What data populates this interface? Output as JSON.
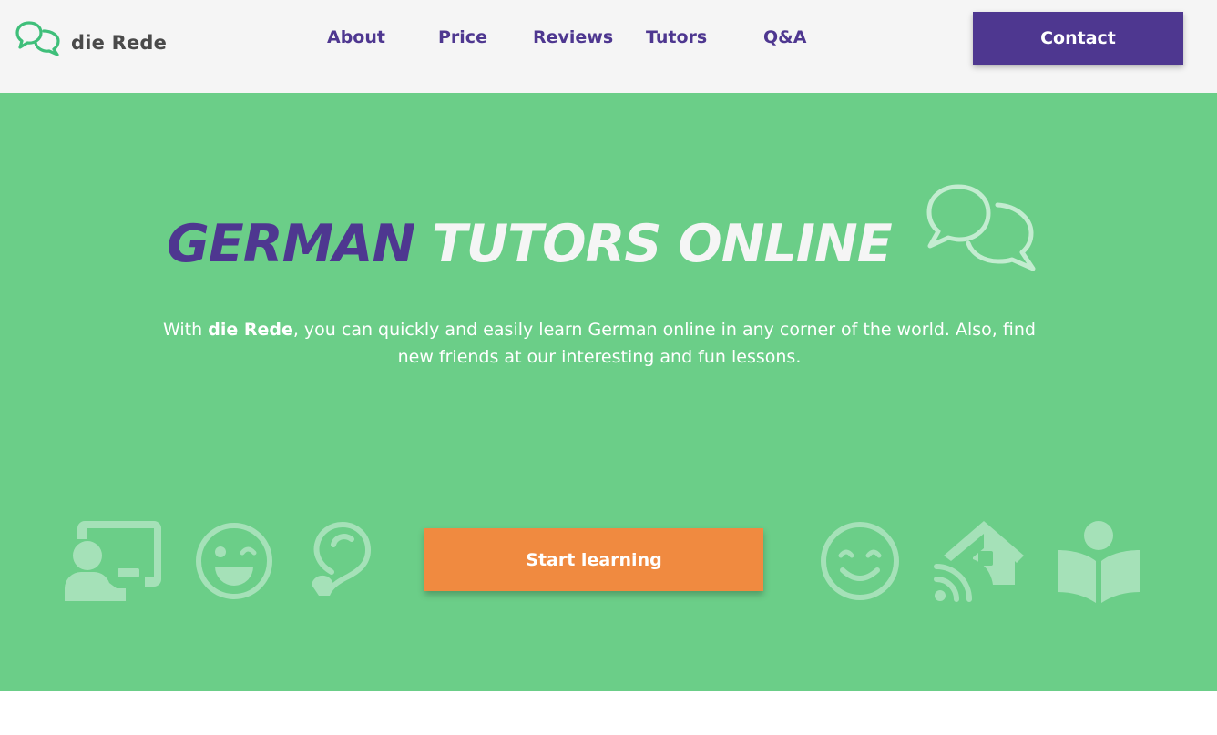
{
  "header": {
    "logo_text": "die Rede",
    "nav": [
      {
        "label": "About"
      },
      {
        "label": "Price"
      },
      {
        "label": "Reviews"
      },
      {
        "label": "Tutors"
      },
      {
        "label": "Q&A"
      }
    ],
    "contact_label": "Contact"
  },
  "hero": {
    "title_part1": "GERMAN",
    "title_part2": "TUTORS ONLINE",
    "desc_prefix": "With ",
    "desc_brand": "die Rede",
    "desc_rest": ", you can quickly and easily learn German online in any corner of the world. Also, find new friends at our interesting and fun lessons.",
    "cta_label": "Start learning",
    "icons": [
      "teacher-board-icon",
      "wink-face-icon",
      "lightbulb-icon",
      "smile-face-icon",
      "home-wifi-icon",
      "reading-book-icon"
    ]
  },
  "colors": {
    "brand_purple": "#4e3790",
    "hero_green": "#6bce88",
    "cta_orange": "#f08a40",
    "header_bg": "#f5f5f5"
  }
}
